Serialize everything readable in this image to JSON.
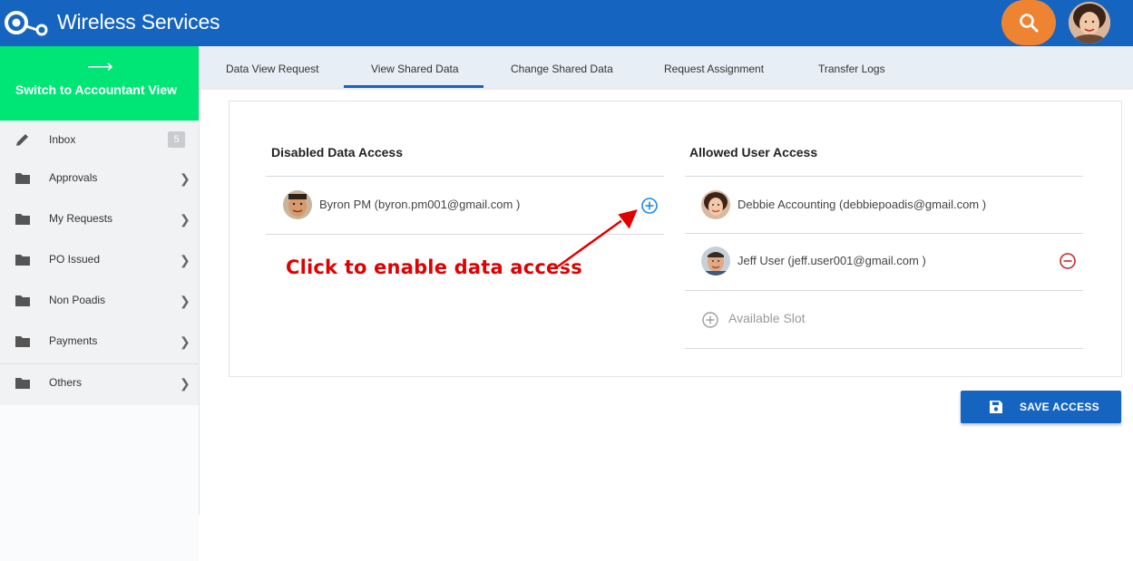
{
  "header": {
    "title": "Wireless Services",
    "logo_icon": "logo-icon",
    "search_icon": "search-icon",
    "accent_color": "#1565c0",
    "search_color": "#ee8432"
  },
  "sidebar": {
    "switch_view_label": "Switch to Accountant View",
    "switch_view_color": "#00e676",
    "items": [
      {
        "label": "Inbox",
        "icon": "pencil-icon",
        "badge": "5"
      },
      {
        "label": "Approvals",
        "icon": "folder-icon"
      },
      {
        "label": "My Requests",
        "icon": "folder-icon"
      },
      {
        "label": "PO Issued",
        "icon": "folder-icon"
      },
      {
        "label": "Non Poadis",
        "icon": "folder-icon"
      },
      {
        "label": "Payments",
        "icon": "folder-icon"
      },
      {
        "label": "Others",
        "icon": "folder-icon"
      }
    ]
  },
  "tabs": [
    {
      "label": "Data View Request"
    },
    {
      "label": "View Shared Data",
      "active": true
    },
    {
      "label": "Change Shared Data"
    },
    {
      "label": "Request Assignment"
    },
    {
      "label": "Transfer Logs"
    }
  ],
  "disabled_access": {
    "title": "Disabled Data Access",
    "users": [
      {
        "name": "Byron PM (byron.pm001@gmail.com )",
        "action_icon": "plus-circle-icon"
      }
    ]
  },
  "allowed_access": {
    "title": "Allowed User Access",
    "users": [
      {
        "name": "Debbie Accounting (debbiepoadis@gmail.com )"
      },
      {
        "name": "Jeff User (jeff.user001@gmail.com )",
        "action_icon": "minus-circle-icon"
      }
    ],
    "available_slot_label": "Available Slot"
  },
  "annotation": {
    "text": "Click to enable data access",
    "color": "#e00000"
  },
  "save_button": {
    "label": "SAVE ACCESS",
    "icon": "save-icon"
  }
}
